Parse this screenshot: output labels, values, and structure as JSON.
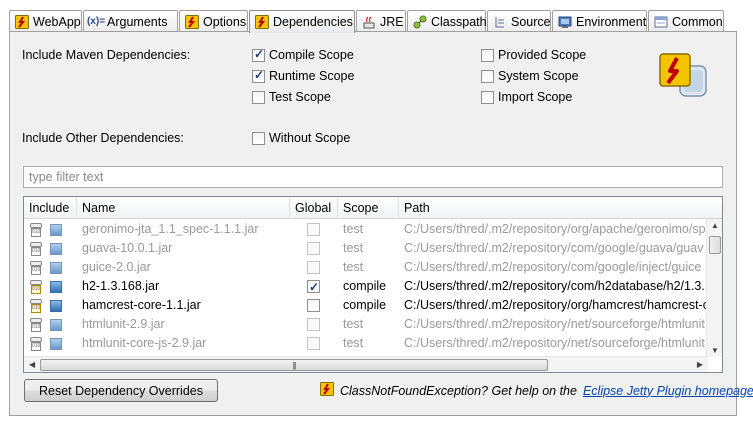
{
  "tabs": [
    {
      "label": "WebApp",
      "icon": "jetty-icon"
    },
    {
      "label": "Arguments",
      "icon": "arguments-icon"
    },
    {
      "label": "Options",
      "icon": "jetty-icon"
    },
    {
      "label": "Dependencies",
      "icon": "jetty-icon",
      "active": true
    },
    {
      "label": "JRE",
      "icon": "jre-icon"
    },
    {
      "label": "Classpath",
      "icon": "classpath-icon"
    },
    {
      "label": "Source",
      "icon": "source-icon"
    },
    {
      "label": "Environment",
      "icon": "environment-icon"
    },
    {
      "label": "Common",
      "icon": "common-icon"
    }
  ],
  "maven": {
    "label": "Include Maven Dependencies:",
    "compile": {
      "label": "Compile Scope",
      "checked": true
    },
    "runtime": {
      "label": "Runtime Scope",
      "checked": true
    },
    "test": {
      "label": "Test Scope",
      "checked": false
    },
    "provided": {
      "label": "Provided Scope",
      "checked": false
    },
    "system": {
      "label": "System Scope",
      "checked": false
    },
    "import": {
      "label": "Import Scope",
      "checked": false
    }
  },
  "other": {
    "label": "Include Other Dependencies:",
    "without_scope": {
      "label": "Without Scope",
      "checked": false
    }
  },
  "filter": {
    "placeholder": "type filter text"
  },
  "table": {
    "columns": [
      "Include",
      "Name",
      "Global",
      "Scope",
      "Path"
    ],
    "rows": [
      {
        "name": "geronimo-jta_1.1_spec-1.1.1.jar",
        "global": false,
        "scope": "test",
        "path": "C:/Users/thred/.m2/repository/org/apache/geronimo/sp",
        "enabled": false
      },
      {
        "name": "guava-10.0.1.jar",
        "global": false,
        "scope": "test",
        "path": "C:/Users/thred/.m2/repository/com/google/guava/guav",
        "enabled": false
      },
      {
        "name": "guice-2.0.jar",
        "global": false,
        "scope": "test",
        "path": "C:/Users/thred/.m2/repository/com/google/inject/guice",
        "enabled": false
      },
      {
        "name": "h2-1.3.168.jar",
        "global": true,
        "scope": "compile",
        "path": "C:/Users/thred/.m2/repository/com/h2database/h2/1.3.1",
        "enabled": true
      },
      {
        "name": "hamcrest-core-1.1.jar",
        "global": false,
        "scope": "compile",
        "path": "C:/Users/thred/.m2/repository/org/hamcrest/hamcrest-c",
        "enabled": true
      },
      {
        "name": "htmlunit-2.9.jar",
        "global": false,
        "scope": "test",
        "path": "C:/Users/thred/.m2/repository/net/sourceforge/htmlunit",
        "enabled": false
      },
      {
        "name": "htmlunit-core-js-2.9.jar",
        "global": false,
        "scope": "test",
        "path": "C:/Users/thred/.m2/repository/net/sourceforge/htmlunit",
        "enabled": false
      }
    ]
  },
  "reset_button": {
    "label": "Reset Dependency Overrides"
  },
  "help": {
    "message": "ClassNotFoundException? Get help on the",
    "link": "Eclipse Jetty Plugin homepage",
    "suffix": "."
  },
  "colors": {
    "accent": "#f5c400",
    "link": "#0645ad",
    "panel": "#f0f0f0"
  }
}
